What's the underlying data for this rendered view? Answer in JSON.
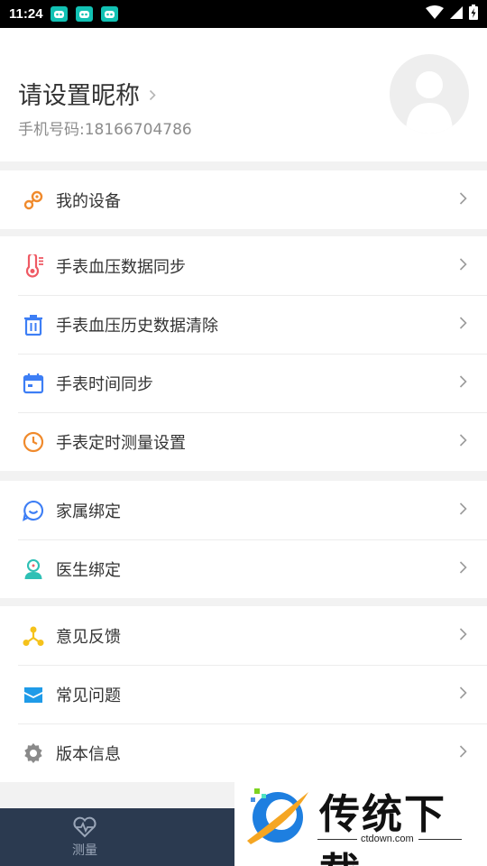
{
  "status_bar": {
    "time": "11:24",
    "notification_icons": [
      "app-notification-icon",
      "app-notification-icon",
      "app-notification-icon"
    ],
    "right_icons": [
      "wifi-icon",
      "signal-icon",
      "battery-charging-icon"
    ]
  },
  "profile": {
    "nickname": "请设置昵称",
    "phone": "手机号码:18166704786",
    "avatar_icon": "default-avatar-icon"
  },
  "menu_groups": [
    {
      "items": [
        {
          "label": "我的设备",
          "icon": "device-icon",
          "color": "#f08a2c"
        }
      ]
    },
    {
      "items": [
        {
          "label": "手表血压数据同步",
          "icon": "thermometer-icon",
          "color": "#ef5a64"
        },
        {
          "label": "手表血压历史数据清除",
          "icon": "trash-icon",
          "color": "#3d7ef5"
        },
        {
          "label": "手表时间同步",
          "icon": "calendar-icon",
          "color": "#3d7ef5"
        },
        {
          "label": "手表定时测量设置",
          "icon": "clock-icon",
          "color": "#f08a2c"
        }
      ]
    },
    {
      "items": [
        {
          "label": "家属绑定",
          "icon": "family-icon",
          "color": "#3d7ef5"
        },
        {
          "label": "医生绑定",
          "icon": "doctor-icon",
          "color": "#2ec0b5"
        }
      ]
    },
    {
      "items": [
        {
          "label": "意见反馈",
          "icon": "feedback-icon",
          "color": "#f5c21b"
        },
        {
          "label": "常见问题",
          "icon": "faq-icon",
          "color": "#1f9be8"
        },
        {
          "label": "版本信息",
          "icon": "settings-gear-icon",
          "color": "#8a8a8a"
        }
      ]
    }
  ],
  "bottom_nav": {
    "tabs": [
      {
        "label": "测量",
        "icon": "heart-pulse-icon"
      }
    ]
  },
  "watermark": {
    "text": "传统下载",
    "url": "ctdown.com"
  },
  "colors": {
    "nav_bg": "#2b3a50",
    "page_bg": "#f2f2f2"
  }
}
